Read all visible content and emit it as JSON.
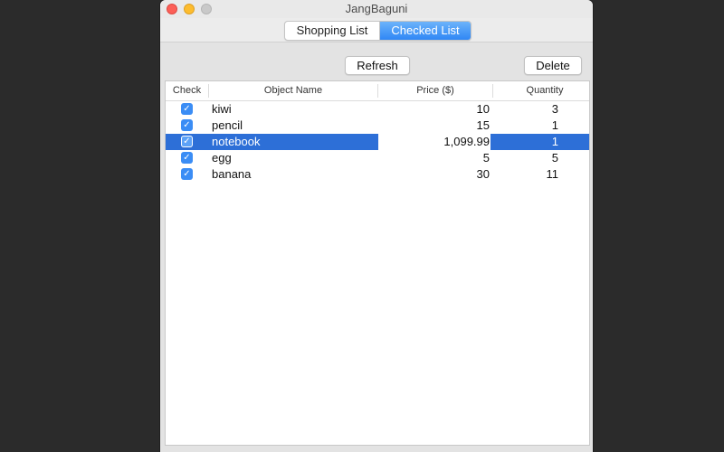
{
  "window": {
    "title": "JangBaguni"
  },
  "tabs": [
    {
      "label": "Shopping List",
      "selected": false
    },
    {
      "label": "Checked List",
      "selected": true
    }
  ],
  "toolbar": {
    "refresh_label": "Refresh",
    "delete_label": "Delete"
  },
  "table": {
    "columns": [
      "Check",
      "Object Name",
      "Price ($)",
      "Quantity"
    ],
    "rows": [
      {
        "checked": true,
        "name": "kiwi",
        "price": "10",
        "quantity": "3"
      },
      {
        "checked": true,
        "name": "pencil",
        "price": "15",
        "quantity": "1"
      },
      {
        "checked": true,
        "name": "notebook",
        "price": "1,099.99",
        "quantity": "1",
        "selected": true,
        "editing": "price"
      },
      {
        "checked": true,
        "name": "egg",
        "price": "5",
        "quantity": "5"
      },
      {
        "checked": true,
        "name": "banana",
        "price": "30",
        "quantity": "11"
      }
    ]
  },
  "colors": {
    "selection": "#2d6fd7",
    "accent": "#3b8df5"
  }
}
